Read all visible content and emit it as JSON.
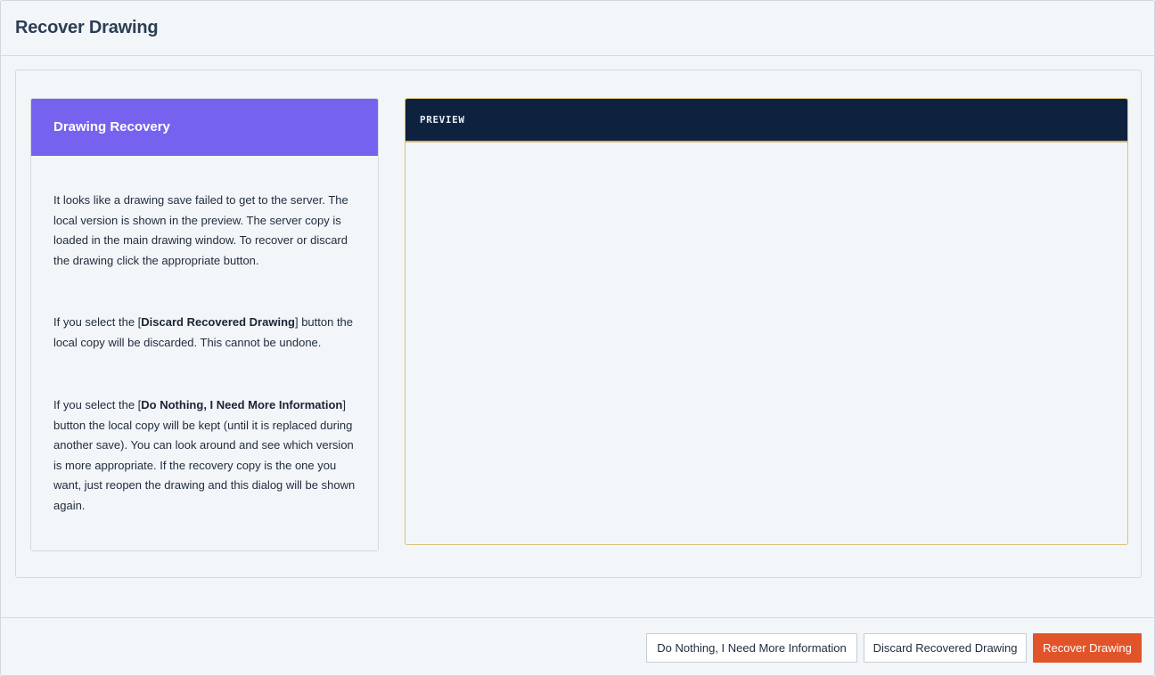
{
  "dialog": {
    "title": "Recover Drawing"
  },
  "info_card": {
    "title": "Drawing Recovery",
    "paragraph1": "It looks like a drawing save failed to get to the server. The local version is shown in the preview. The server copy is loaded in the main drawing window. To recover or discard the drawing click the appropriate button.",
    "paragraph2_prefix": "If you select the [",
    "paragraph2_bold": "Discard Recovered Drawing",
    "paragraph2_suffix": "] button the local copy will be discarded. This cannot be undone.",
    "paragraph3_prefix": "If you select the [",
    "paragraph3_bold": "Do Nothing, I Need More Information",
    "paragraph3_suffix": "] button the local copy will be kept (until it is replaced during another save). You can look around and see which version is more appropriate. If the recovery copy is the one you want, just reopen the drawing and this dialog will be shown again."
  },
  "preview": {
    "label": "PREVIEW"
  },
  "footer": {
    "do_nothing_label": "Do Nothing, I Need More Information",
    "discard_label": "Discard Recovered Drawing",
    "recover_label": "Recover Drawing"
  },
  "colors": {
    "accent_purple": "#7563ef",
    "preview_header_navy": "#0e2240",
    "preview_border_gold": "#d9b56a",
    "primary_button_orange": "#e1542a"
  }
}
